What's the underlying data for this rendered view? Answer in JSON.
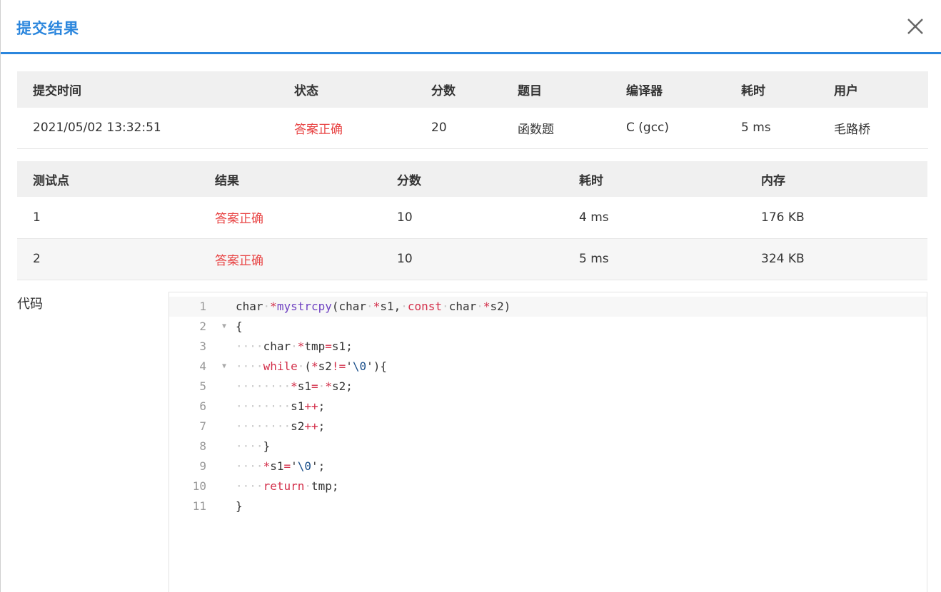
{
  "dialog": {
    "title": "提交结果",
    "close_icon": "close-icon"
  },
  "submission": {
    "headers": [
      "提交时间",
      "状态",
      "分数",
      "题目",
      "编译器",
      "耗时",
      "用户"
    ],
    "row": [
      "2021/05/02 13:32:51",
      "答案正确",
      "20",
      "函数题",
      "C (gcc)",
      "5 ms",
      "毛路桥"
    ]
  },
  "testcases": {
    "headers": [
      "测试点",
      "结果",
      "分数",
      "耗时",
      "内存"
    ],
    "rows": [
      [
        "1",
        "答案正确",
        "10",
        "4 ms",
        "176 KB"
      ],
      [
        "2",
        "答案正确",
        "10",
        "5 ms",
        "324 KB"
      ]
    ]
  },
  "code": {
    "label": "代码",
    "line_numbers": [
      "1",
      "2",
      "3",
      "4",
      "5",
      "6",
      "7",
      "8",
      "9",
      "10",
      "11"
    ],
    "lines": [
      "char *mystrcpy(char *s1, const char *s2)",
      "{",
      "    char *tmp=s1;",
      "    while (*s2!='\\0'){",
      "        *s1= *s2;",
      "        s1++;",
      "        s2++;",
      "    }",
      "    *s1='\\0';",
      "    return tmp;",
      "}"
    ]
  },
  "colors": {
    "accent": "#2b86dd",
    "success": "#e84545",
    "header_bg": "#f0f0f0"
  }
}
